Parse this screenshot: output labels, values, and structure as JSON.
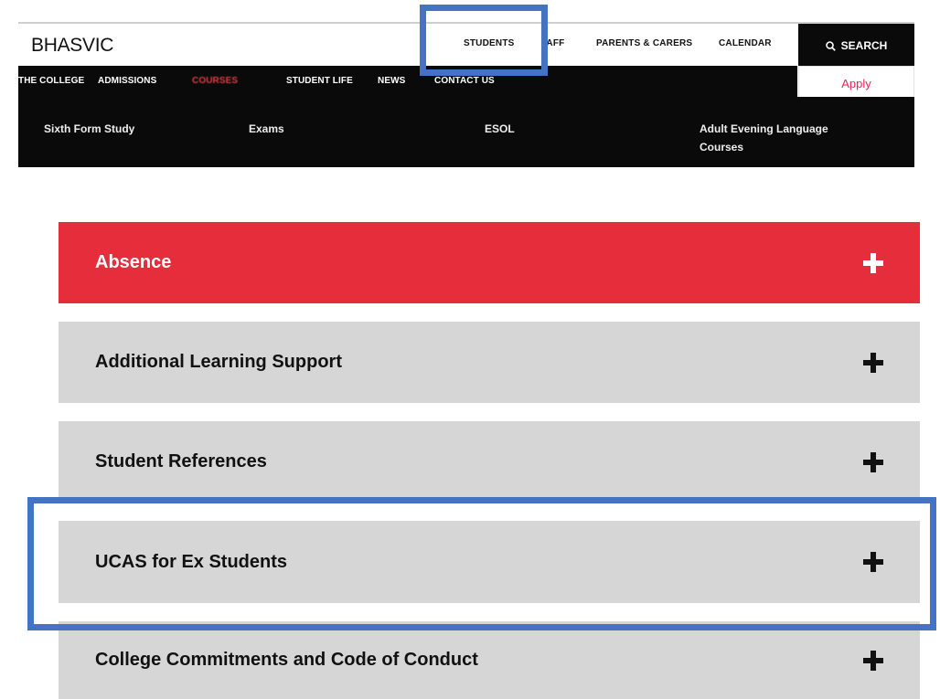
{
  "header": {
    "logo": "BHASVIC",
    "util_links": [
      "STUDENTS",
      "STAFF",
      "PARENTS & CARERS",
      "CALENDAR"
    ],
    "search_label": "SEARCH",
    "search_icon": "search-icon"
  },
  "nav": {
    "items": [
      "THE COLLEGE",
      "ADMISSIONS",
      "COURSES",
      "STUDENT LIFE",
      "NEWS",
      "CONTACT US"
    ],
    "active_index": 2,
    "apply_label": "Apply"
  },
  "submenu": {
    "items": [
      "Sixth Form Study",
      "Exams",
      "ESOL",
      "Adult Evening Language Courses"
    ]
  },
  "accordion": {
    "items": [
      {
        "title": "Absence",
        "expanded": false,
        "highlighted": true
      },
      {
        "title": "Additional Learning Support",
        "expanded": false
      },
      {
        "title": "Student References",
        "expanded": false
      },
      {
        "title": "UCAS for Ex Students",
        "expanded": false
      },
      {
        "title": "College Commitments and Code of Conduct",
        "expanded": false
      }
    ],
    "toggle_icon": "plus-icon"
  },
  "colors": {
    "accent_red": "#e62d3b",
    "apply_pink": "#e6245a",
    "annotation_blue": "#4472c4",
    "nav_black": "#0a0a0a",
    "panel_grey": "#d6d6d6"
  }
}
